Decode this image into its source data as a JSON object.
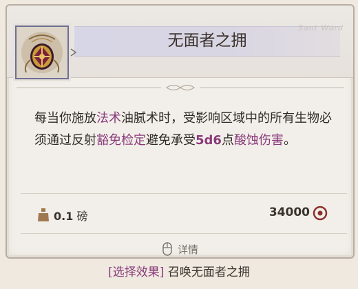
{
  "item": {
    "title": "无面者之拥",
    "icon": "amulet-icon",
    "watermark": "Sant Ward"
  },
  "description": {
    "p1": "每当你施放",
    "kw_spell": "法术",
    "p2": "油腻术时，受影响区域中的所有生物必须通过反射",
    "kw_save": "豁免检定",
    "p3": "避免承受",
    "kw_dice": "5d6",
    "p4": "点",
    "kw_damage": "酸蚀伤害",
    "p5": "。"
  },
  "stats": {
    "weight_value": "0.1",
    "weight_unit": "磅",
    "weight_icon": "weight-icon",
    "price": "34000",
    "price_icon": "gold-coin-icon"
  },
  "footer": {
    "details_label": "详情",
    "details_icon": "mouse-icon",
    "action_bracket": "[选择效果]",
    "action_text": "召唤无面者之拥"
  },
  "colors": {
    "keyword": "#8a3a7a",
    "title_band": "#d7d6e6",
    "frame": "#6f6f93"
  }
}
